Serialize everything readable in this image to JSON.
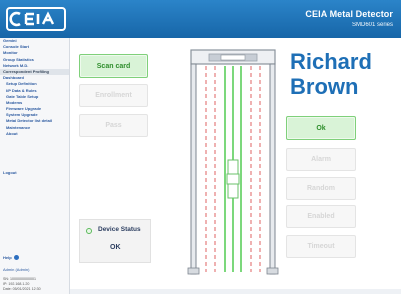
{
  "header": {
    "logo_text": "CEIA",
    "title": "CEIA Metal Detector",
    "subtitle": "SMD601 series"
  },
  "sidebar": {
    "items": [
      {
        "label": "Gemini",
        "type": "item"
      },
      {
        "label": "Console Start",
        "type": "item"
      },
      {
        "label": "Monitor",
        "type": "item"
      },
      {
        "label": "Group Statistics",
        "type": "item"
      },
      {
        "label": "Network M.D.",
        "type": "item"
      },
      {
        "label": "Correspondent Profiling",
        "type": "section"
      },
      {
        "label": "Dashboard",
        "type": "item"
      },
      {
        "label": "Setup Definition",
        "type": "sub"
      },
      {
        "label": "I/P Data & Rules",
        "type": "sub"
      },
      {
        "label": "Gate Table Setup",
        "type": "sub"
      },
      {
        "label": "Modems",
        "type": "sub"
      },
      {
        "label": "Firmware Upgrade",
        "type": "sub"
      },
      {
        "label": "System Upgrade",
        "type": "sub"
      },
      {
        "label": "Metal Detector list detail",
        "type": "sub"
      },
      {
        "label": "Maintenance",
        "type": "sub"
      },
      {
        "label": "About",
        "type": "sub"
      }
    ],
    "logout_label": "Logout",
    "help_label": "Help",
    "user_label": "Admin (Admin)",
    "sys_info": [
      "SN: 1000000000001",
      "IP: 192.168.1.20",
      "Date: 05/01/2021 12:30"
    ]
  },
  "actions": {
    "scan_card": "Scan card",
    "enrollment": "Enrollment",
    "pass": "Pass",
    "ok": "Ok",
    "alarm": "Alarm",
    "random": "Random",
    "enabled": "Enabled",
    "timeout": "Timeout"
  },
  "device_status": {
    "label": "Device Status",
    "value": "OK"
  },
  "person": {
    "first_name": "Richard",
    "last_name": "Brown"
  },
  "colors": {
    "header_blue": "#1c70b3",
    "accent_green": "#7fd07a",
    "name_blue": "#1e6fb6",
    "column_red": "#e88c8c"
  }
}
